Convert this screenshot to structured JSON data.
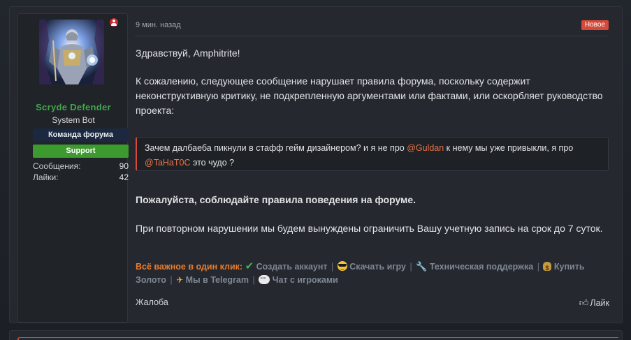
{
  "author": {
    "username": "Scryde Defender",
    "user_title": "System Bot",
    "banner_team": "Команда форума",
    "banner_support": "Support",
    "stats": [
      {
        "label": "Сообщения:",
        "value": "90"
      },
      {
        "label": "Лайки:",
        "value": "42"
      }
    ],
    "avatar_icon": "knight-avatar",
    "status_icon": "user-offline-icon"
  },
  "message": {
    "time": "9 мин. назад",
    "badge": "Новое",
    "greeting": "Здравствуй, Amphitrite!",
    "paragraph1": "К сожалению, следующее сообщение нарушает правила форума, поскольку содержит неконструктивную критику, не подкрепленную аргументами или фактами, или оскорбляет руководство проекта:",
    "quote": {
      "part1": "Зачем далбаеба пикнули в стафф гейм дизайнером? и я не про ",
      "mention1": "@Guldan",
      "part2": " к нему мы уже привыкли, я про ",
      "mention2": "@TaHaT0C",
      "part3": " это чудо ?"
    },
    "rules_bold": "Пожалуйста, соблюдайте правила поведения на форуме.",
    "paragraph2": "При повторном нарушении мы будем вынуждены ограничить Вашу учетную запись на срок до 7 суток."
  },
  "links": {
    "lead": "Всё важное в один клик:",
    "create_account": "Создать аккаунт",
    "download_game": "Скачать игру",
    "tech_support": "Техническая поддержка",
    "buy_gold": "Купить Золото",
    "telegram": "Мы в Telegram",
    "chat": "Чат с игроками",
    "separator": "|"
  },
  "footer": {
    "report": "Жалоба",
    "like": "Лайк"
  },
  "colors": {
    "username": "#3fa84a",
    "badge_new": "#d44a3a",
    "mention": "#e8744a",
    "lead": "#e87d2e",
    "support_banner": "#3c9a2e"
  }
}
